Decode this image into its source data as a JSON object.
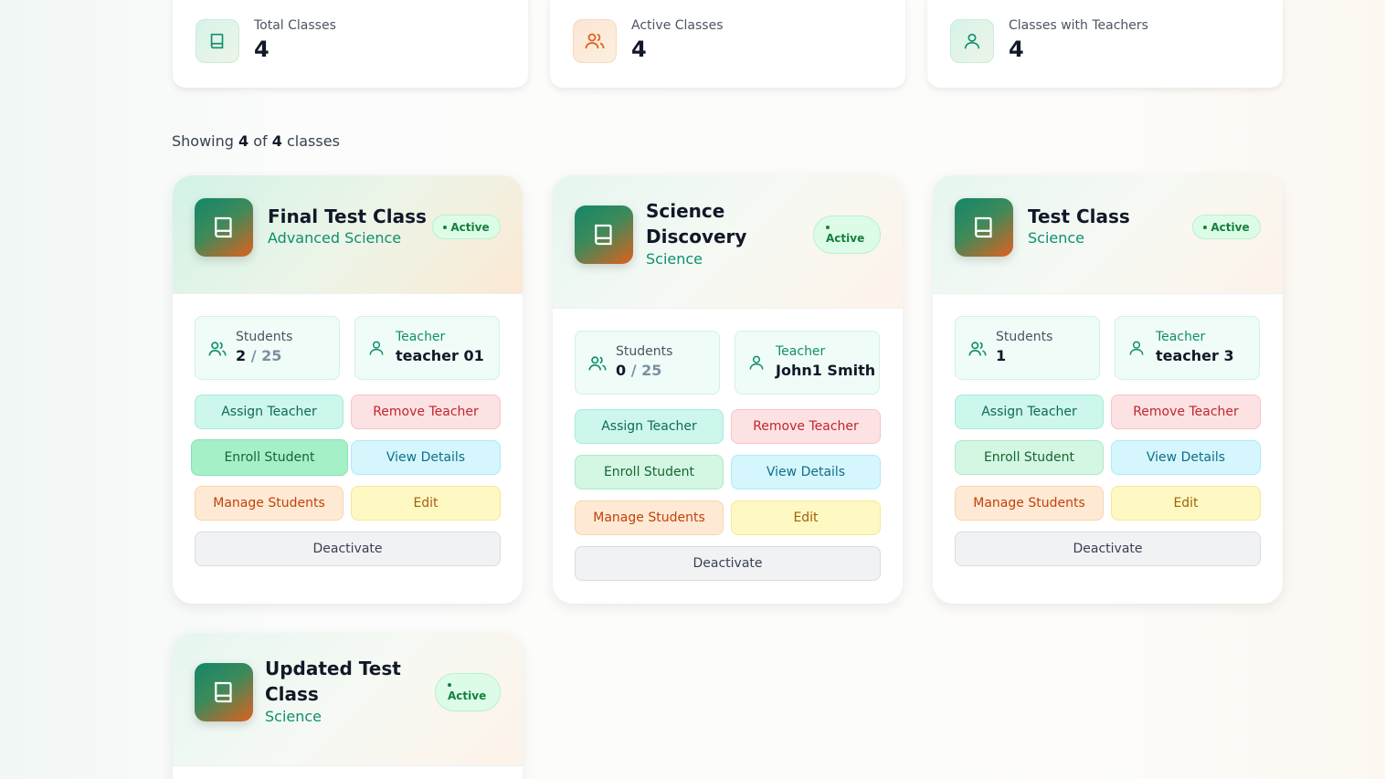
{
  "stats": [
    {
      "label": "Total Classes",
      "value": "4",
      "icon": "book-icon"
    },
    {
      "label": "Active Classes",
      "value": "4",
      "icon": "users-icon"
    },
    {
      "label": "Classes with Teachers",
      "value": "4",
      "icon": "user-icon"
    }
  ],
  "showing": {
    "prefix": "Showing",
    "count": "4",
    "of": "of",
    "total": "4",
    "suffix": "classes"
  },
  "labels": {
    "students": "Students",
    "teacher": "Teacher",
    "separator": "/",
    "assign": "Assign Teacher",
    "remove": "Remove Teacher",
    "enroll": "Enroll Student",
    "view": "View Details",
    "manage": "Manage Students",
    "edit": "Edit",
    "deactivate": "Deactivate"
  },
  "classes": [
    {
      "name": "Final Test Class",
      "subject": "Advanced Science",
      "status": "Active",
      "students": "2",
      "capacity": "25",
      "teacher": "teacher 01"
    },
    {
      "name_line1": "Science",
      "name_line2": "Discovery",
      "subject": "Science",
      "status": "Active",
      "students": "0",
      "capacity": "25",
      "teacher": "John1 Smith"
    },
    {
      "name": "Test Class",
      "subject": "Science",
      "status": "Active",
      "students": "1",
      "teacher": "teacher 3"
    },
    {
      "name_line1": "Updated Test",
      "name_line2": "Class",
      "subject": "Science",
      "status": "Active"
    }
  ],
  "colors": {
    "accent": "#0f8f6f",
    "active_badge": "#dcfce7",
    "danger": "#c0262d"
  }
}
